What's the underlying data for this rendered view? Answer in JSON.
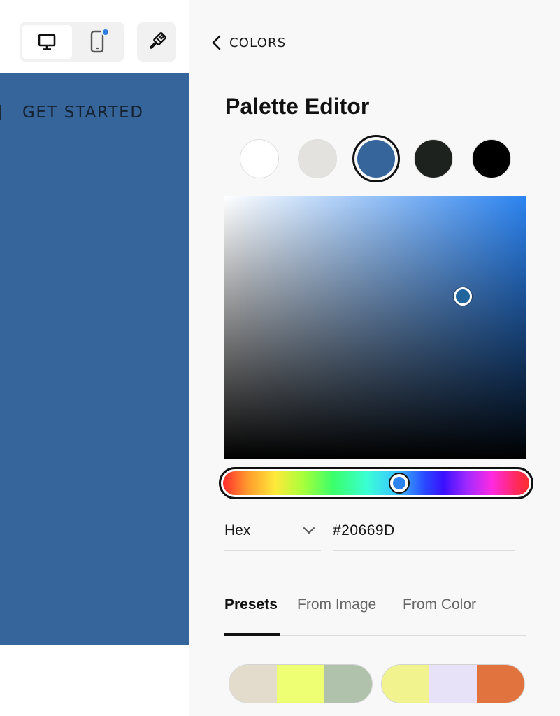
{
  "left": {
    "nav_fragment": "L",
    "nav_link": "GET STARTED",
    "preview_color": "#35659B",
    "device_toggle": {
      "desktop_icon": "desktop-monitor-icon",
      "mobile_icon": "mobile-phone-icon",
      "mobile_has_notification": true
    },
    "style_icon": "paintbrush-icon"
  },
  "panel": {
    "back_icon": "chevron-left-icon",
    "back_label": "COLORS",
    "title": "Palette Editor",
    "swatches": [
      {
        "color": "#FFFFFF",
        "selected": false
      },
      {
        "color": "#E3E2DE",
        "selected": false
      },
      {
        "color": "#35659B",
        "selected": true
      },
      {
        "color": "#1E221E",
        "selected": false
      },
      {
        "color": "#000000",
        "selected": false
      }
    ],
    "picker": {
      "hue_color": "#2B83F0",
      "saturation": 0.79,
      "value": 0.62,
      "hue_fraction": 0.575
    },
    "format_select": {
      "label": "Hex",
      "icon": "chevron-down-icon"
    },
    "hex_value": "#20669D",
    "tabs": [
      {
        "label": "Presets",
        "active": true
      },
      {
        "label": "From Image",
        "active": false
      },
      {
        "label": "From Color",
        "active": false
      }
    ],
    "presets": [
      {
        "colors": [
          "#E3DCCC",
          "#EEFF73",
          "#B0C2AC"
        ]
      },
      {
        "colors": [
          "#F1F38E",
          "#E8E2F9",
          "#E0733E"
        ]
      }
    ]
  }
}
